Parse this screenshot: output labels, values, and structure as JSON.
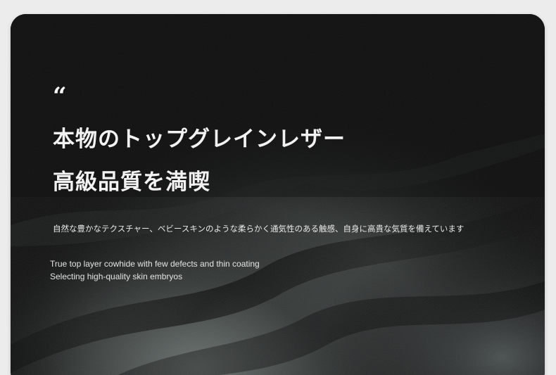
{
  "banner": {
    "quote_mark": "“",
    "headline_line1": "本物のトップグレインレザー",
    "headline_line2": "高級品質を満喫",
    "description_jp": "自然な豊かなテクスチャー、ベビースキンのような柔らかく通気性のある触感、自身に高貴な気質を備えています",
    "description_en_line1": "True top layer cowhide with few defects and thin coating",
    "description_en_line2": "Selecting high-quality skin embryos"
  },
  "colors": {
    "background": "#ececec",
    "card": "#101010",
    "text": "#f2f2f2"
  }
}
